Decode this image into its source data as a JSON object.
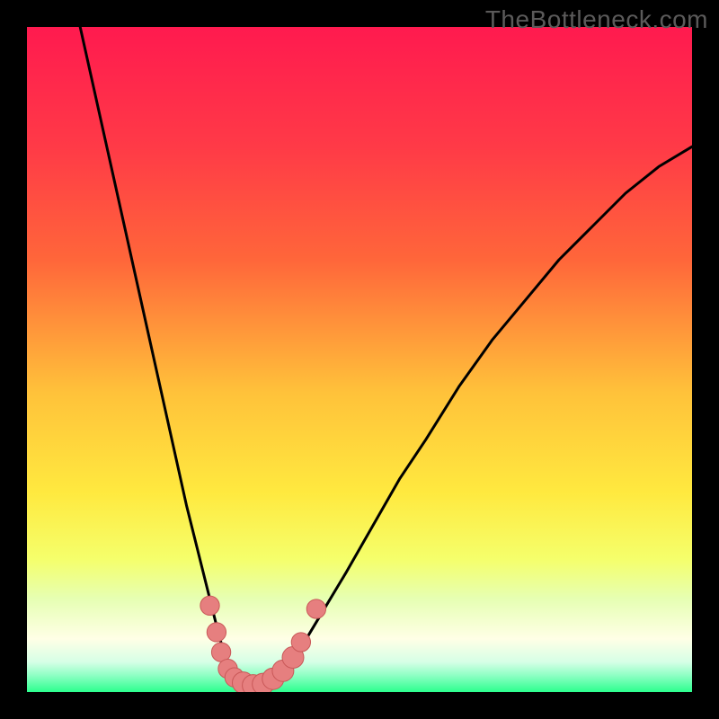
{
  "watermark": "TheBottleneck.com",
  "colors": {
    "black": "#000000",
    "gradient_top": "#ff1a4f",
    "gradient_mid1": "#ff663a",
    "gradient_mid2": "#ffc23a",
    "gradient_mid3": "#ffe93f",
    "gradient_mid4": "#f5ff6b",
    "gradient_bottom_band": "#e6ffb3",
    "gradient_bottom_pale": "#d6ffe6",
    "gradient_bottom_green": "#2cff8e",
    "curve": "#000000",
    "marker_fill": "#e67f7f",
    "marker_stroke": "#c95858"
  },
  "chart_data": {
    "type": "line",
    "title": "",
    "xlabel": "",
    "ylabel": "",
    "xlim": [
      0,
      100
    ],
    "ylim": [
      0,
      100
    ],
    "grid": false,
    "legend": false,
    "series": [
      {
        "name": "bottleneck-curve",
        "x": [
          8,
          10,
          12,
          14,
          16,
          18,
          20,
          22,
          24,
          25,
          26,
          27,
          28,
          29,
          30,
          31,
          32,
          33,
          34,
          35,
          36,
          38,
          40,
          42,
          45,
          48,
          52,
          56,
          60,
          65,
          70,
          75,
          80,
          85,
          90,
          95,
          100
        ],
        "y": [
          100,
          91,
          82,
          73,
          64,
          55,
          46,
          37,
          28,
          24,
          20,
          16,
          12,
          8,
          5,
          3,
          2,
          1.3,
          1,
          1,
          1.3,
          2.5,
          5,
          8,
          13,
          18,
          25,
          32,
          38,
          46,
          53,
          59,
          65,
          70,
          75,
          79,
          82
        ]
      }
    ],
    "markers": [
      {
        "x": 27.5,
        "y": 13,
        "r": 1.6
      },
      {
        "x": 28.5,
        "y": 9,
        "r": 1.6
      },
      {
        "x": 29.2,
        "y": 6,
        "r": 1.6
      },
      {
        "x": 30.2,
        "y": 3.5,
        "r": 1.6
      },
      {
        "x": 31.2,
        "y": 2.2,
        "r": 1.6
      },
      {
        "x": 32.5,
        "y": 1.4,
        "r": 1.8
      },
      {
        "x": 34.0,
        "y": 1.0,
        "r": 1.8
      },
      {
        "x": 35.5,
        "y": 1.2,
        "r": 1.8
      },
      {
        "x": 37.0,
        "y": 2.0,
        "r": 1.8
      },
      {
        "x": 38.5,
        "y": 3.2,
        "r": 1.8
      },
      {
        "x": 40.0,
        "y": 5.2,
        "r": 1.8
      },
      {
        "x": 41.2,
        "y": 7.5,
        "r": 1.6
      },
      {
        "x": 43.5,
        "y": 12.5,
        "r": 1.6
      }
    ]
  }
}
